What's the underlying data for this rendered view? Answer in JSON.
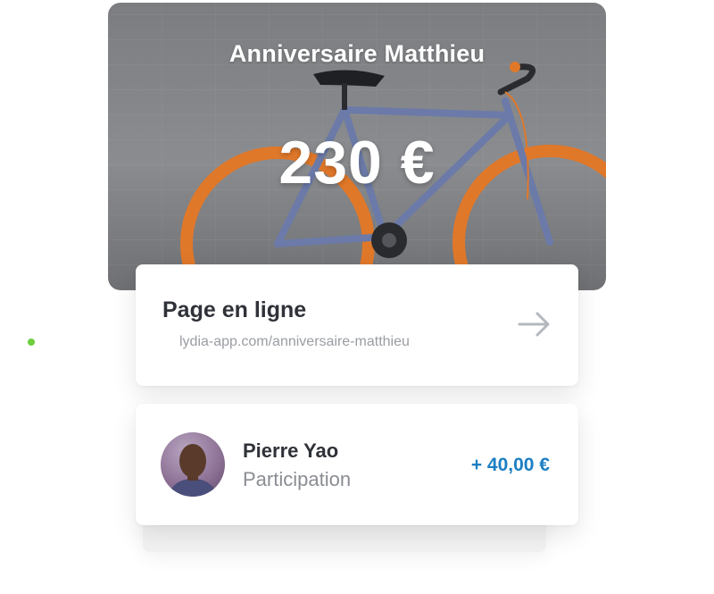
{
  "hero": {
    "title": "Anniversaire Matthieu",
    "amount": "230 €"
  },
  "online_page": {
    "title": "Page en ligne",
    "url": "lydia-app.com/anniversaire-matthieu",
    "status_color": "#6dce3f",
    "arrow_icon": "arrow-right-icon"
  },
  "participation": {
    "name": "Pierre Yao",
    "label": "Participation",
    "amount": "+ 40,00 €",
    "amount_color": "#1c7fc3"
  }
}
